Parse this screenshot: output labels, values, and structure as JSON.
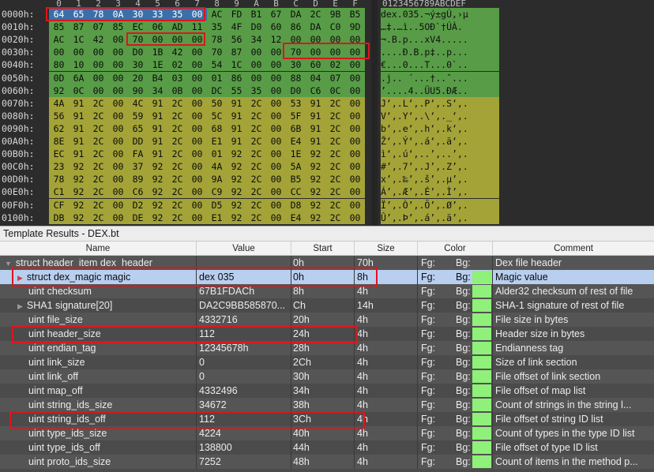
{
  "hex": {
    "col_headers": [
      "0",
      "1",
      "2",
      "3",
      "4",
      "5",
      "6",
      "7",
      "8",
      "9",
      "A",
      "B",
      "C",
      "D",
      "E",
      "F"
    ],
    "ascii_header": "0123456789ABCDEF",
    "rows": [
      {
        "offset": "0000h:",
        "bytes": [
          "64",
          "65",
          "78",
          "0A",
          "30",
          "33",
          "35",
          "00",
          "AC",
          "FD",
          "B1",
          "67",
          "DA",
          "2C",
          "9B",
          "B5"
        ],
        "ascii": "dex.035.¬ý±gÚ,›µ",
        "group": 1
      },
      {
        "offset": "0010h:",
        "bytes": [
          "85",
          "87",
          "07",
          "85",
          "EC",
          "06",
          "AD",
          "11",
          "35",
          "4F",
          "D0",
          "60",
          "86",
          "DA",
          "C0",
          "9D"
        ],
        "ascii": "…‡.…ì.­.5OÐ`†ÚÀ.",
        "group": 1
      },
      {
        "offset": "0020h:",
        "bytes": [
          "AC",
          "1C",
          "42",
          "00",
          "70",
          "00",
          "00",
          "00",
          "78",
          "56",
          "34",
          "12",
          "00",
          "00",
          "00",
          "00"
        ],
        "ascii": "¬.B.p...xV4.....",
        "group": 1
      },
      {
        "offset": "0030h:",
        "bytes": [
          "00",
          "00",
          "00",
          "00",
          "D0",
          "1B",
          "42",
          "00",
          "70",
          "87",
          "00",
          "00",
          "70",
          "00",
          "00",
          "00"
        ],
        "ascii": "....Ð.B.p‡..p...",
        "group": 1
      },
      {
        "offset": "0040h:",
        "bytes": [
          "80",
          "10",
          "00",
          "00",
          "30",
          "1E",
          "02",
          "00",
          "54",
          "1C",
          "00",
          "00",
          "30",
          "60",
          "02",
          "00"
        ],
        "ascii": "€...0...T...0`..",
        "group": 1
      },
      {
        "offset": "0050h:",
        "bytes": [
          "0D",
          "6A",
          "00",
          "00",
          "20",
          "B4",
          "03",
          "00",
          "01",
          "86",
          "00",
          "00",
          "88",
          "04",
          "07",
          "00"
        ],
        "ascii": ".j.. ´...†..ˆ...",
        "group": 1
      },
      {
        "offset": "0060h:",
        "bytes": [
          "92",
          "0C",
          "00",
          "00",
          "90",
          "34",
          "0B",
          "00",
          "DC",
          "55",
          "35",
          "00",
          "D0",
          "C6",
          "0C",
          "00"
        ],
        "ascii": "’....4..ÜU5.ÐÆ..",
        "group": 1
      },
      {
        "offset": "0070h:",
        "bytes": [
          "4A",
          "91",
          "2C",
          "00",
          "4C",
          "91",
          "2C",
          "00",
          "50",
          "91",
          "2C",
          "00",
          "53",
          "91",
          "2C",
          "00"
        ],
        "ascii": "J‘,.L‘,.P‘,.S‘,.",
        "group": 2
      },
      {
        "offset": "0080h:",
        "bytes": [
          "56",
          "91",
          "2C",
          "00",
          "59",
          "91",
          "2C",
          "00",
          "5C",
          "91",
          "2C",
          "00",
          "5F",
          "91",
          "2C",
          "00"
        ],
        "ascii": "V‘,.Y‘,.\\‘,._‘,.",
        "group": 2
      },
      {
        "offset": "0090h:",
        "bytes": [
          "62",
          "91",
          "2C",
          "00",
          "65",
          "91",
          "2C",
          "00",
          "68",
          "91",
          "2C",
          "00",
          "6B",
          "91",
          "2C",
          "00"
        ],
        "ascii": "b‘,.e‘,.h‘,.k‘,.",
        "group": 2
      },
      {
        "offset": "00A0h:",
        "bytes": [
          "8E",
          "91",
          "2C",
          "00",
          "DD",
          "91",
          "2C",
          "00",
          "E1",
          "91",
          "2C",
          "00",
          "E4",
          "91",
          "2C",
          "00"
        ],
        "ascii": "Ž‘,.Ý‘,.á‘,.ä‘,.",
        "group": 2
      },
      {
        "offset": "00B0h:",
        "bytes": [
          "EC",
          "91",
          "2C",
          "00",
          "FA",
          "91",
          "2C",
          "00",
          "01",
          "92",
          "2C",
          "00",
          "1E",
          "92",
          "2C",
          "00"
        ],
        "ascii": "ì‘,.ú‘,..’,..’,.",
        "group": 2
      },
      {
        "offset": "00C0h:",
        "bytes": [
          "23",
          "92",
          "2C",
          "00",
          "37",
          "92",
          "2C",
          "00",
          "4A",
          "92",
          "2C",
          "00",
          "5A",
          "92",
          "2C",
          "00"
        ],
        "ascii": "#’,.7’,.J’,.Z’,.",
        "group": 2
      },
      {
        "offset": "00D0h:",
        "bytes": [
          "78",
          "92",
          "2C",
          "00",
          "89",
          "92",
          "2C",
          "00",
          "9A",
          "92",
          "2C",
          "00",
          "B5",
          "92",
          "2C",
          "00"
        ],
        "ascii": "x’,.‰’,.š’,.µ’,.",
        "group": 2
      },
      {
        "offset": "00E0h:",
        "bytes": [
          "C1",
          "92",
          "2C",
          "00",
          "C6",
          "92",
          "2C",
          "00",
          "C9",
          "92",
          "2C",
          "00",
          "CC",
          "92",
          "2C",
          "00"
        ],
        "ascii": "Á’,.Æ’,.É’,.Ì’,.",
        "group": 2
      },
      {
        "offset": "00F0h:",
        "bytes": [
          "CF",
          "92",
          "2C",
          "00",
          "D2",
          "92",
          "2C",
          "00",
          "D5",
          "92",
          "2C",
          "00",
          "D8",
          "92",
          "2C",
          "00"
        ],
        "ascii": "Ï’,.Ò’,.Õ’,.Ø’,.",
        "group": 2
      },
      {
        "offset": "0100h:",
        "bytes": [
          "DB",
          "92",
          "2C",
          "00",
          "DE",
          "92",
          "2C",
          "00",
          "E1",
          "92",
          "2C",
          "00",
          "E4",
          "92",
          "2C",
          "00"
        ],
        "ascii": "Û’,.Þ’,.á’,.ä’,.",
        "group": 2
      }
    ]
  },
  "results": {
    "title": "Template Results - DEX.bt",
    "columns": {
      "name": "Name",
      "value": "Value",
      "start": "Start",
      "size": "Size",
      "color": "Color",
      "comment": "Comment"
    },
    "rows": [
      {
        "name": "struct header_item dex_header",
        "value": "",
        "start": "0h",
        "size": "70h",
        "fg": "Fg:",
        "bg": "Bg:",
        "comment": "Dex file header",
        "indent": 0,
        "tri": "▼",
        "swatch": false
      },
      {
        "name": "struct dex_magic magic",
        "value": "dex 035",
        "start": "0h",
        "size": "8h",
        "fg": "Fg:",
        "bg": "Bg:",
        "comment": "Magic value",
        "indent": 1,
        "tri": "▶",
        "swatch": true
      },
      {
        "name": "uint checksum",
        "value": "67B1FDACh",
        "start": "8h",
        "size": "4h",
        "fg": "Fg:",
        "bg": "Bg:",
        "comment": "Alder32 checksum of rest of file",
        "indent": 2,
        "tri": "",
        "swatch": true
      },
      {
        "name": "SHA1 signature[20]",
        "value": "DA2C9BB585870...",
        "start": "Ch",
        "size": "14h",
        "fg": "Fg:",
        "bg": "Bg:",
        "comment": "SHA-1 signature of rest of file",
        "indent": 1,
        "tri": "▶",
        "swatch": true
      },
      {
        "name": "uint file_size",
        "value": "4332716",
        "start": "20h",
        "size": "4h",
        "fg": "Fg:",
        "bg": "Bg:",
        "comment": "File size in bytes",
        "indent": 2,
        "tri": "",
        "swatch": true
      },
      {
        "name": "uint header_size",
        "value": "112",
        "start": "24h",
        "size": "4h",
        "fg": "Fg:",
        "bg": "Bg:",
        "comment": "Header size in bytes",
        "indent": 2,
        "tri": "",
        "swatch": true
      },
      {
        "name": "uint endian_tag",
        "value": "12345678h",
        "start": "28h",
        "size": "4h",
        "fg": "Fg:",
        "bg": "Bg:",
        "comment": "Endianness tag",
        "indent": 2,
        "tri": "",
        "swatch": true
      },
      {
        "name": "uint link_size",
        "value": "0",
        "start": "2Ch",
        "size": "4h",
        "fg": "Fg:",
        "bg": "Bg:",
        "comment": "Size of link section",
        "indent": 2,
        "tri": "",
        "swatch": true
      },
      {
        "name": "uint link_off",
        "value": "0",
        "start": "30h",
        "size": "4h",
        "fg": "Fg:",
        "bg": "Bg:",
        "comment": "File offset of link section",
        "indent": 2,
        "tri": "",
        "swatch": true
      },
      {
        "name": "uint map_off",
        "value": "4332496",
        "start": "34h",
        "size": "4h",
        "fg": "Fg:",
        "bg": "Bg:",
        "comment": "File offset of map list",
        "indent": 2,
        "tri": "",
        "swatch": true
      },
      {
        "name": "uint string_ids_size",
        "value": "34672",
        "start": "38h",
        "size": "4h",
        "fg": "Fg:",
        "bg": "Bg:",
        "comment": "Count of strings in the string l...",
        "indent": 2,
        "tri": "",
        "swatch": true
      },
      {
        "name": "uint string_ids_off",
        "value": "112",
        "start": "3Ch",
        "size": "4h",
        "fg": "Fg:",
        "bg": "Bg:",
        "comment": "File offset of string ID list",
        "indent": 2,
        "tri": "",
        "swatch": true
      },
      {
        "name": "uint type_ids_size",
        "value": "4224",
        "start": "40h",
        "size": "4h",
        "fg": "Fg:",
        "bg": "Bg:",
        "comment": "Count of types in the type ID list",
        "indent": 2,
        "tri": "",
        "swatch": true
      },
      {
        "name": "uint type_ids_off",
        "value": "138800",
        "start": "44h",
        "size": "4h",
        "fg": "Fg:",
        "bg": "Bg:",
        "comment": "File offset of type ID list",
        "indent": 2,
        "tri": "",
        "swatch": true
      },
      {
        "name": "uint proto_ids_size",
        "value": "7252",
        "start": "48h",
        "size": "4h",
        "fg": "Fg:",
        "bg": "Bg:",
        "comment": "Count of items in the method p...",
        "indent": 2,
        "tri": "",
        "swatch": true
      }
    ]
  },
  "colors": {
    "green_region": "#589c47",
    "olive_region": "#a3a338",
    "selected_row": "#b8cff0",
    "swatch": "#8ff07a",
    "annotation_red": "#e0151b"
  }
}
